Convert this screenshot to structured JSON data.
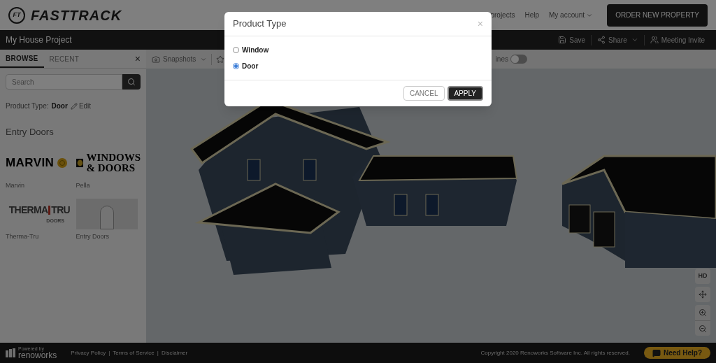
{
  "header": {
    "logo_mark": "FT",
    "logo_text": "FASTTRACK",
    "nav": [
      {
        "label": "projects",
        "dropdown": false
      },
      {
        "label": "Help",
        "dropdown": false
      },
      {
        "label": "My account",
        "dropdown": true
      }
    ],
    "order_button": "ORDER NEW PROPERTY"
  },
  "project_bar": {
    "title": "My House Project",
    "actions": [
      {
        "label": "Save",
        "kind": "save",
        "dropdown": false
      },
      {
        "label": "Share",
        "kind": "share",
        "dropdown": true
      },
      {
        "label": "Meeting Invite",
        "kind": "invite",
        "dropdown": false
      }
    ]
  },
  "sidebar": {
    "tabs": [
      {
        "label": "BROWSE",
        "selected": true
      },
      {
        "label": "RECENT",
        "selected": false
      }
    ],
    "close": "×",
    "search": {
      "placeholder": "Search"
    },
    "filter_label": "Product Type:",
    "filter_value": "Door",
    "edit": "Edit",
    "section": "Entry Doors",
    "products": [
      {
        "name": "Marvin",
        "kind": "marvin",
        "logo_text": [
          "MARVIN"
        ]
      },
      {
        "name": "Pella",
        "kind": "pella",
        "logo_text": [
          "WINDOWS",
          "& DOORS"
        ]
      },
      {
        "name": "Therma-Tru",
        "kind": "thermatru",
        "logo_text": [
          "THERMA",
          "TRU",
          "DOORS"
        ]
      },
      {
        "name": "Entry Doors",
        "kind": "photo"
      }
    ]
  },
  "toolbar": {
    "snapshots": "Snapshots",
    "toggle_label": "ines",
    "toggle_on": false
  },
  "viewport_controls": {
    "hd": "HD"
  },
  "modal": {
    "title": "Product Type",
    "close": "×",
    "options": [
      {
        "label": "Window",
        "selected": false
      },
      {
        "label": "Door",
        "selected": true
      }
    ],
    "buttons": [
      {
        "label": "CANCEL",
        "kind": "secondary"
      },
      {
        "label": "APPLY",
        "kind": "primary"
      }
    ]
  },
  "footer": {
    "powered_by": "Powered by",
    "brand": "renoworks",
    "links": [
      "Privacy Policy",
      "Terms of Service",
      "Disclaimer"
    ],
    "link_separator": "|",
    "copyright": "Copyright 2020 Renoworks Software Inc. All rights reserved.",
    "help_button": "Need Help?"
  }
}
